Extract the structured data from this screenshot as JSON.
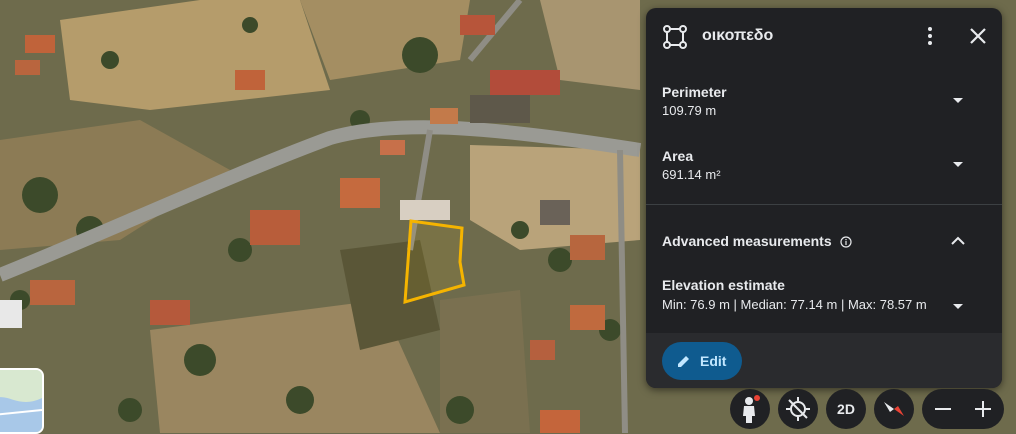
{
  "panel": {
    "title": "οικοπεδο",
    "perimeter": {
      "label": "Perimeter",
      "value": "109.79 m"
    },
    "area": {
      "label": "Area",
      "value": "691.14 m²"
    },
    "advanced": {
      "label": "Advanced measurements"
    },
    "elevation": {
      "label": "Elevation estimate",
      "value": "Min: 76.9 m | Median: 77.14 m | Max: 78.57 m"
    },
    "edit_label": "Edit"
  },
  "controls": {
    "view_mode_label": "2D"
  },
  "icons": {
    "shape": "polygon-shape-icon",
    "more": "more-vert-icon",
    "close": "close-icon",
    "expand": "chevron-down-icon",
    "collapse": "chevron-up-icon",
    "info": "info-icon",
    "edit": "pencil-icon",
    "pegman": "street-view-pegman-icon",
    "location": "my-location-disabled-icon",
    "compass": "compass-icon",
    "zoom_out": "minus-icon",
    "zoom_in": "plus-icon"
  },
  "colors": {
    "panel_bg": "#202124",
    "accent_button": "#0f5b8f",
    "polygon_outline": "#f5b400",
    "road": "#9a9a94"
  }
}
